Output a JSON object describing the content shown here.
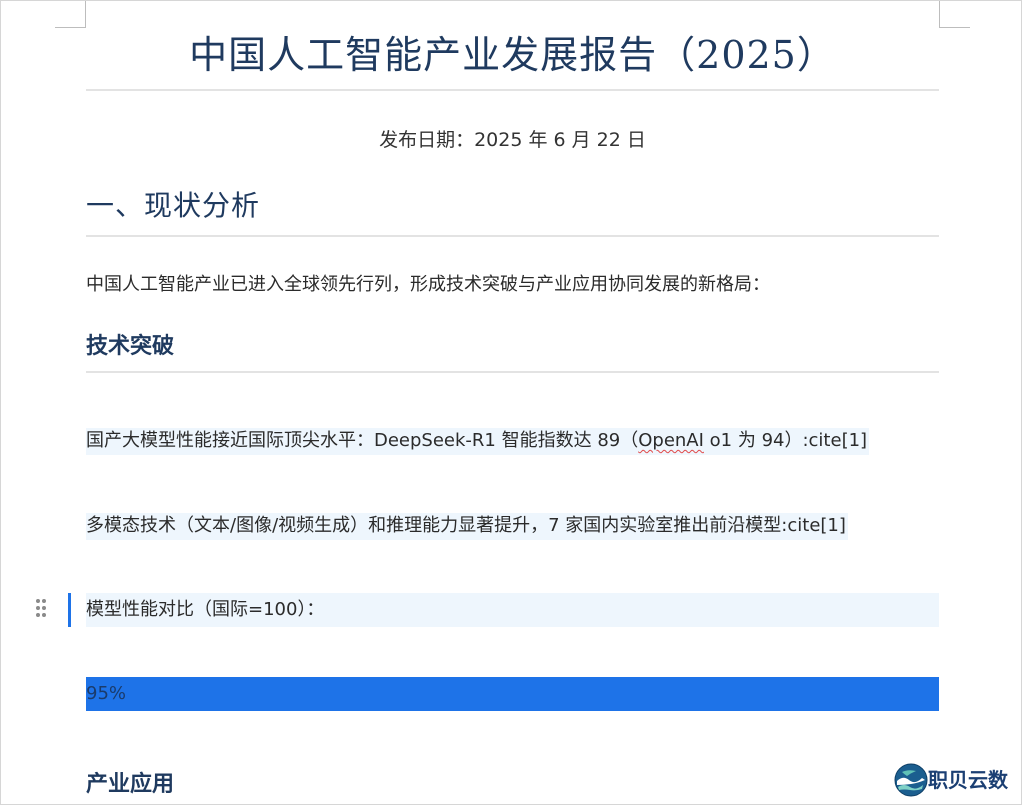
{
  "document": {
    "title": "中国人工智能产业发展报告（2025）",
    "publish_date": "发布日期：2025 年 6 月 22 日",
    "section1": {
      "heading": "一、现状分析",
      "intro": "中国人工智能产业已进入全球领先行列，形成技术突破与产业应用协同发展的新格局：",
      "subsection_tech": {
        "heading": "技术突破",
        "item1_prefix": "国产大模型性能接近国际顶尖水平：DeepSeek-R1 智能指数达 89（",
        "item1_err": "OpenAI",
        "item1_suffix": " o1 为 94）:cite[1]",
        "item2": "多模态技术（文本/图像/视频生成）和推理能力显著提升，7 家国内实验室推出前沿模型:cite[1]",
        "comparison_label": "模型性能对比（国际=100）：",
        "bar": {
          "label": "95%",
          "value_percent": 100
        }
      },
      "subsection_industry": {
        "heading": "产业应用"
      }
    }
  },
  "brand": {
    "name": "职贝云数",
    "logo_icon": "zhibei-wave-logo-icon"
  },
  "colors": {
    "heading": "#1f3a5f",
    "accent": "#1e73e8",
    "highlight_bg": "#eef6fd"
  }
}
